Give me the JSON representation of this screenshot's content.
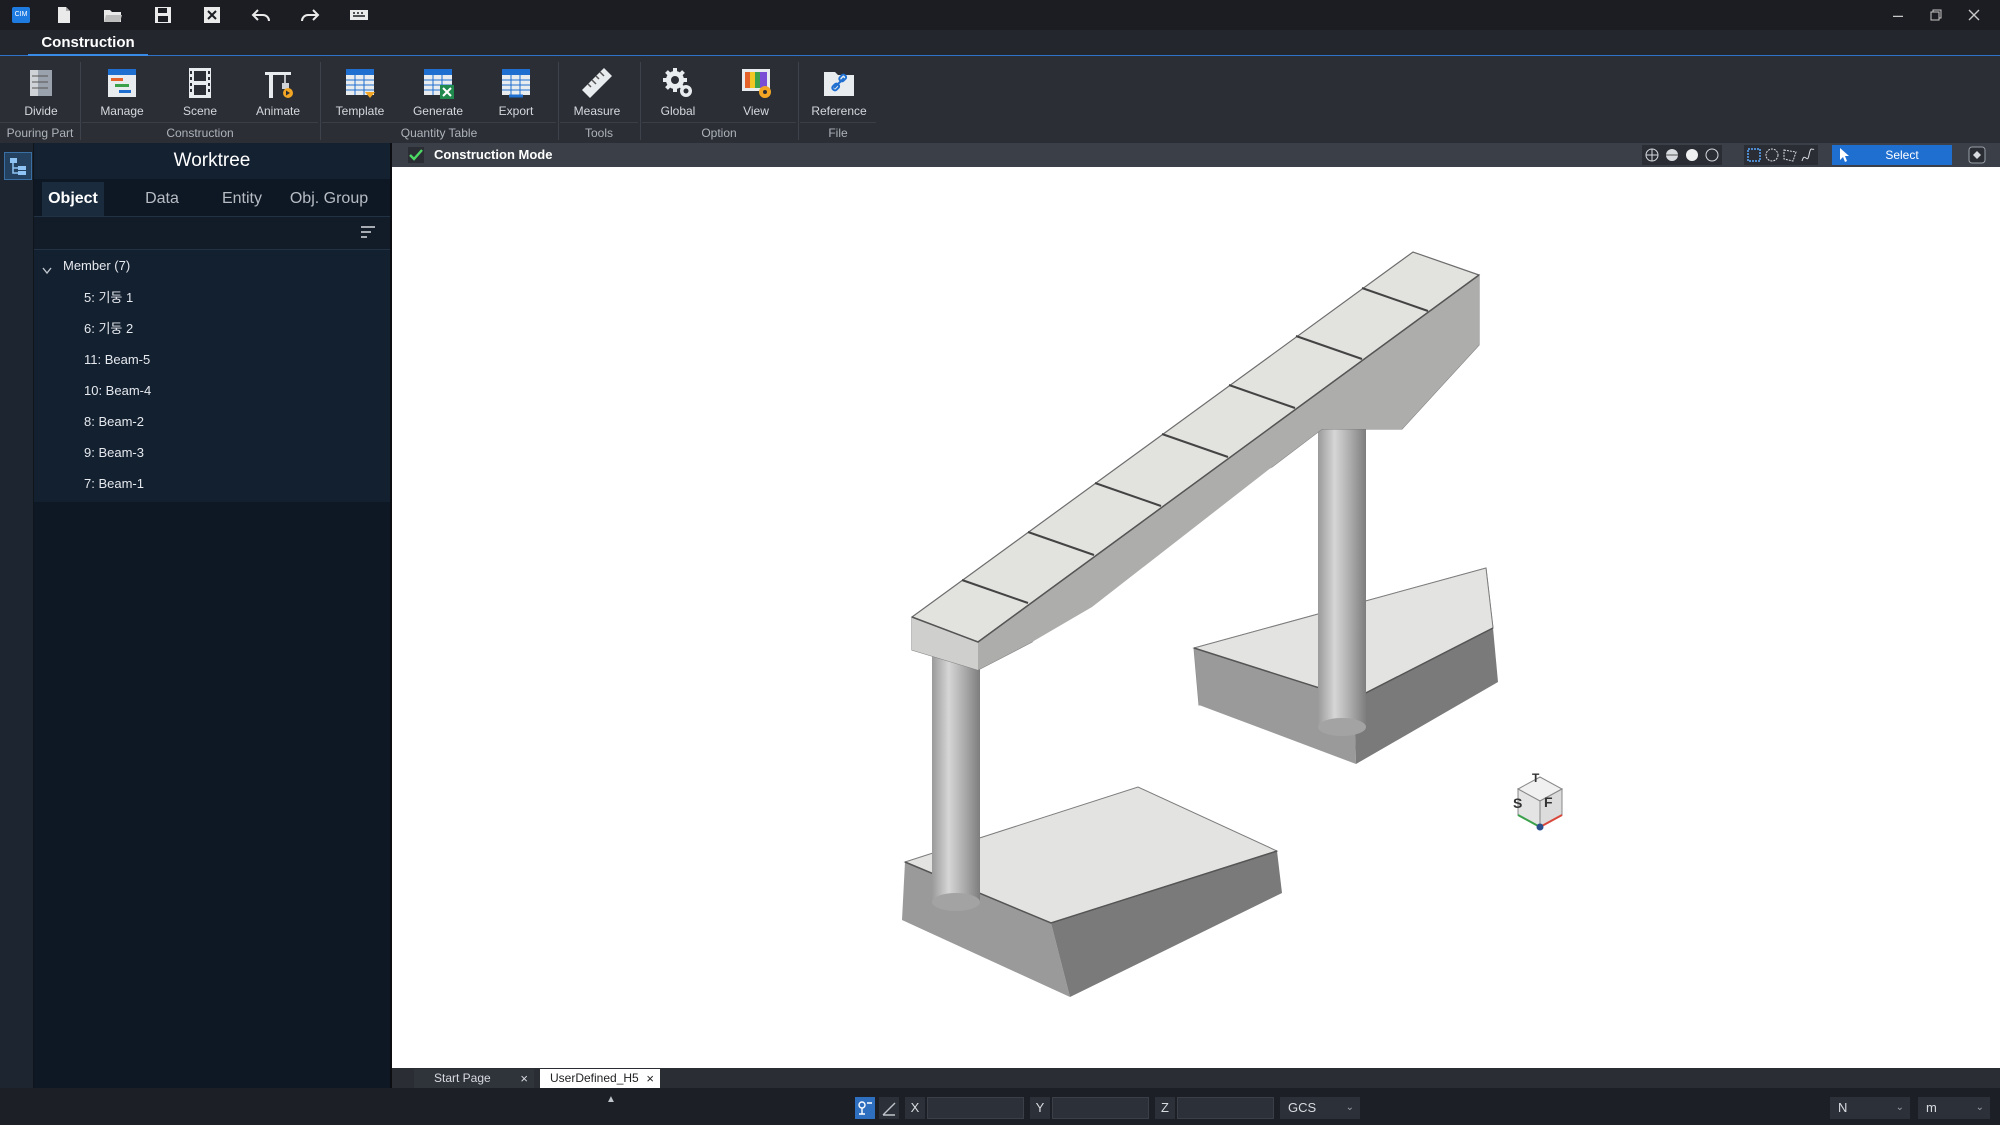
{
  "app": {
    "title_icon": "app-logo-icon",
    "quick_access": [
      {
        "name": "new-file-icon"
      },
      {
        "name": "open-folder-icon"
      },
      {
        "name": "save-icon"
      },
      {
        "name": "close-file-icon"
      },
      {
        "name": "undo-icon"
      },
      {
        "name": "redo-icon"
      },
      {
        "name": "keyboard-icon"
      }
    ]
  },
  "ribbon": {
    "active_tab": "Construction",
    "buttons": {
      "divide": "Divide",
      "manage": "Manage",
      "scene": "Scene",
      "animate": "Animate",
      "template": "Template",
      "generate": "Generate",
      "export": "Export",
      "measure": "Measure",
      "global": "Global",
      "view": "View",
      "reference": "Reference"
    },
    "groups": {
      "pouring_part": "Pouring Part",
      "construction": "Construction",
      "quantity_table": "Quantity Table",
      "tools": "Tools",
      "option": "Option",
      "file": "File"
    }
  },
  "worktree": {
    "title": "Worktree",
    "tabs": [
      "Object",
      "Data",
      "Entity",
      "Obj. Group"
    ],
    "active_tab": "Object",
    "root": "Member (7)",
    "items": [
      "5: 기둥 1",
      "6: 기둥 2",
      "11: Beam-5",
      "10: Beam-4",
      "8: Beam-2",
      "9: Beam-3",
      "7: Beam-1"
    ]
  },
  "viewport": {
    "mode_label": "Construction Mode",
    "select_label": "Select",
    "accent_color": "#1f6fd0",
    "view_cube_faces": [
      "T",
      "S",
      "F"
    ]
  },
  "document_tabs": [
    {
      "label": "Start Page",
      "active": false
    },
    {
      "label": "UserDefined_H5",
      "active": true
    }
  ],
  "statusbar": {
    "x_label": "X",
    "y_label": "Y",
    "z_label": "Z",
    "coord_system": "GCS",
    "force_unit": "N",
    "length_unit": "m"
  }
}
